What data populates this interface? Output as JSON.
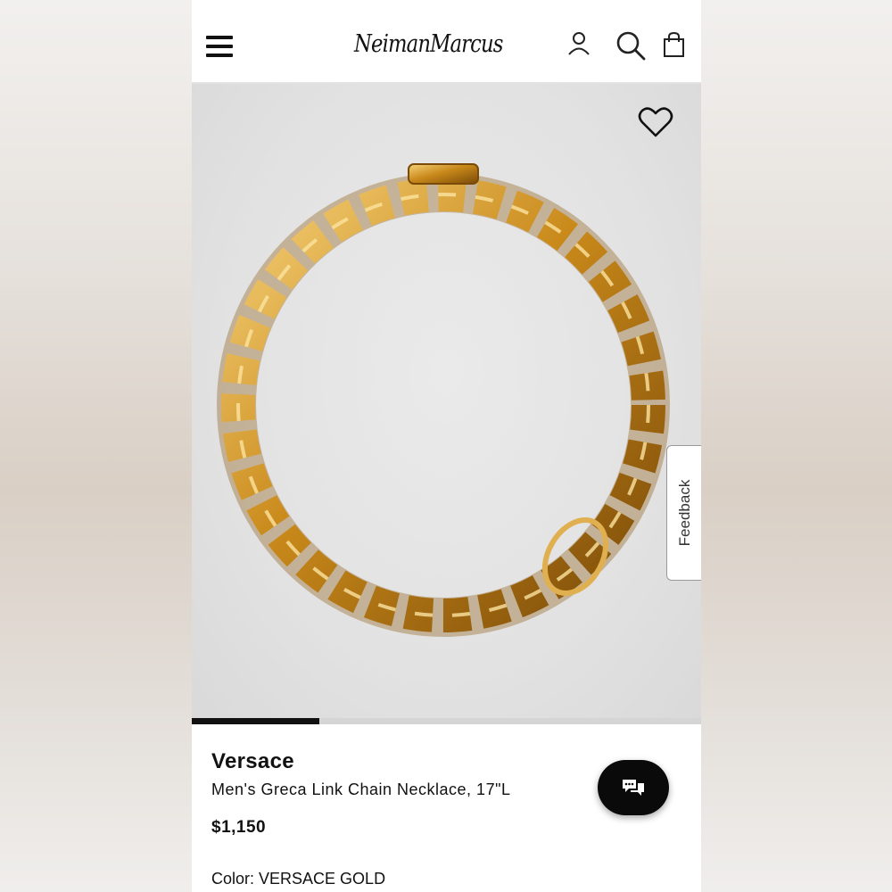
{
  "header": {
    "logo_text": "NeimanMarcus",
    "menu_icon": "hamburger-menu-icon",
    "account_icon": "user-icon",
    "search_icon": "search-icon",
    "bag_icon": "shopping-bag-icon"
  },
  "gallery": {
    "image_subject": "gold chain necklace",
    "favorite_icon": "heart-outline-icon",
    "feedback_label": "Feedback",
    "image_progress": 0.25
  },
  "product": {
    "brand": "Versace",
    "name": "Men's Greca Link Chain Necklace, 17\"L",
    "price": "$1,150",
    "color_label": "Color:",
    "color_value": "VERSACE GOLD"
  },
  "chat": {
    "icon": "chat-bubbles-icon"
  },
  "colors": {
    "accent": "#111111",
    "gold": "#c88a18",
    "background": "#e5e5e5"
  }
}
